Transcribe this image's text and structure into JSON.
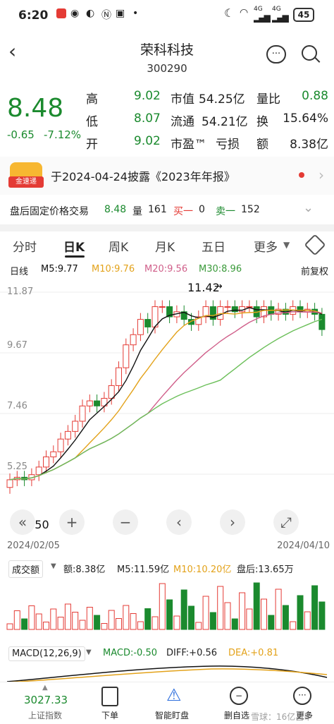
{
  "status": {
    "time": "6:20",
    "battery": "45",
    "net1": "4G",
    "net2": "4G"
  },
  "header": {
    "name": "荣科科技",
    "code": "300290"
  },
  "quote": {
    "price": "8.48",
    "change": "-0.65",
    "change_pct": "-7.12%",
    "high_label": "高",
    "high": "9.02",
    "low_label": "低",
    "low": "8.07",
    "open_label": "开",
    "open": "9.02",
    "mcap_label": "市值",
    "mcap": "54.25亿",
    "float_label": "流通",
    "float": "54.21亿",
    "pe_label": "市盈™",
    "pe": "亏损",
    "vr_label": "量比",
    "vr": "0.88",
    "turn_label": "换",
    "turn": "15.64%",
    "amt_label": "额",
    "amt": "8.38亿"
  },
  "banner": {
    "badge": "金速递",
    "text": "于2024-04-24披露《2023年年报》"
  },
  "after_hours": {
    "label": "盘后固定价格交易",
    "price": "8.48",
    "vol_label": "量",
    "vol": "161",
    "buy_label": "买一",
    "buy": "0",
    "sell_label": "卖一",
    "sell": "152"
  },
  "tabs": [
    "分时",
    "日K",
    "周K",
    "月K",
    "五日",
    "更多"
  ],
  "ma": {
    "label": "日线",
    "m5": "M5:9.77",
    "m10": "M10:9.76",
    "m20": "M20:9.56",
    "m30": "M30:8.96",
    "adj": "前复权"
  },
  "axis": {
    "y1": "11.87",
    "y2": "9.67",
    "y3": "7.46",
    "y4": "5.25",
    "low_label": "3.50",
    "high_label": "11.42",
    "date_start": "2024/02/05",
    "date_end": "2024/04/10"
  },
  "volume": {
    "label": "成交额",
    "amt": "额:8.38亿",
    "m5": "M5:11.59亿",
    "m10": "M10:10.20亿",
    "after": "盘后:13.65万"
  },
  "macd": {
    "label": "MACD(12,26,9)",
    "macd": "MACD:-0.50",
    "diff": "DIFF:+0.56",
    "dea": "DEA:+0.81"
  },
  "bottom": {
    "index_value": "3027.33",
    "index_name": "上证指数",
    "order": "下单",
    "smart": "智能盯盘",
    "delete": "删自选",
    "more": "更多",
    "watermark": "雪球：16亿吕甲"
  },
  "colors": {
    "up": "#e43b35",
    "down": "#1b8a2e",
    "ma5": "#111111",
    "ma10": "#e3a21a",
    "ma20": "#d05f8a",
    "ma30": "#6bbf59"
  }
}
